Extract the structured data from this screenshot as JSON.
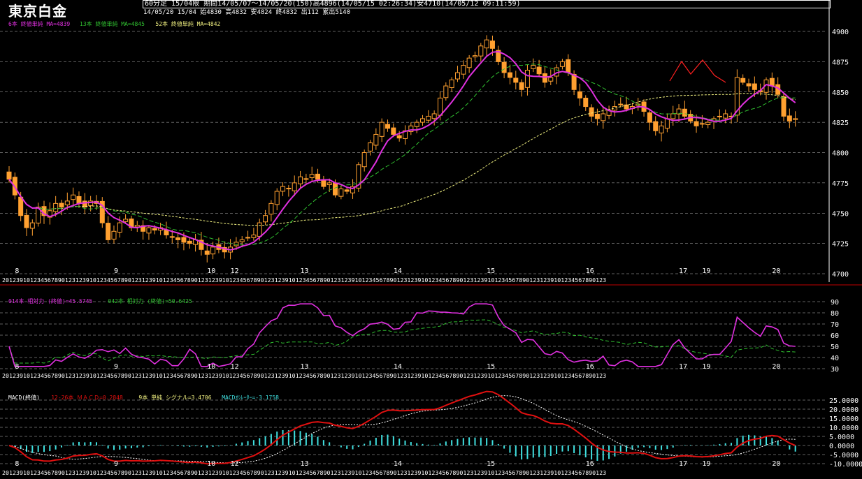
{
  "header": {
    "instrument": "東京白金",
    "line1": "60分足 15/04限  期間14/05/07～14/05/20(150)高4896(14/05/15 02:26:34)安4710(14/05/12 09:11:59)",
    "line2": "14/05/20 15/04 始4830 高4832 安4824 終4832 出112 累出5140"
  },
  "colors": {
    "candle": "#ffa030",
    "ma6": "#e030e0",
    "ma13": "#30c030",
    "ma52": "#f0f080",
    "macd": "#e01010",
    "signal": "#ffffff",
    "hist": "#40e0e0",
    "grid": "#c0c0c0",
    "separator": "#c00000",
    "pattern": "#ff2020"
  },
  "chart_data": [
    {
      "type": "candlestick",
      "panel": "price",
      "legend": [
        {
          "text": "6本 終値単純 MA=4839",
          "color": "#e030e0"
        },
        {
          "text": "13本 終値単純 MA=4845",
          "color": "#30c030"
        },
        {
          "text": "52本 終値単純 MA=4842",
          "color": "#f0f080"
        }
      ],
      "ylim": [
        4700,
        4910
      ],
      "y_ticks": [
        "4900",
        "4875",
        "4850",
        "4825",
        "4800",
        "4775",
        "4750",
        "4725",
        "4700"
      ],
      "day_labels": [
        {
          "label": "8",
          "bar": 1
        },
        {
          "label": "9",
          "bar": 18
        },
        {
          "label": "10",
          "bar": 34
        },
        {
          "label": "12",
          "bar": 38
        },
        {
          "label": "13",
          "bar": 50
        },
        {
          "label": "14",
          "bar": 66
        },
        {
          "label": "15",
          "bar": 82
        },
        {
          "label": "16",
          "bar": 99
        },
        {
          "label": "17",
          "bar": 115
        },
        {
          "label": "19",
          "bar": 119
        },
        {
          "label": "20",
          "bar": 131
        }
      ],
      "hour_row": "20123910123456789012312391012345678901231239101234567890123123910123456789012312391012345678901231239101234567890123123910123456789012312391012345678901231239101234567890123",
      "closes": [
        4778,
        4765,
        4748,
        4738,
        4742,
        4755,
        4748,
        4752,
        4758,
        4755,
        4760,
        4765,
        4758,
        4755,
        4760,
        4758,
        4742,
        4728,
        4735,
        4742,
        4745,
        4738,
        4740,
        4735,
        4738,
        4736,
        4738,
        4732,
        4730,
        4728,
        4726,
        4725,
        4728,
        4720,
        4716,
        4722,
        4720,
        4718,
        4722,
        4726,
        4728,
        4730,
        4732,
        4742,
        4748,
        4758,
        4768,
        4772,
        4770,
        4775,
        4780,
        4778,
        4782,
        4778,
        4772,
        4775,
        4765,
        4770,
        4768,
        4772,
        4790,
        4800,
        4808,
        4815,
        4825,
        4820,
        4815,
        4812,
        4818,
        4822,
        4825,
        4828,
        4830,
        4832,
        4845,
        4855,
        4860,
        4866,
        4872,
        4878,
        4880,
        4888,
        4893,
        4886,
        4875,
        4866,
        4862,
        4858,
        4852,
        4868,
        4872,
        4865,
        4858,
        4862,
        4870,
        4875,
        4866,
        4852,
        4845,
        4838,
        4830,
        4828,
        4832,
        4835,
        4838,
        4840,
        4836,
        4838,
        4840,
        4834,
        4825,
        4818,
        4822,
        4828,
        4832,
        4836,
        4830,
        4826,
        4822,
        4824,
        4825,
        4828,
        4830,
        4832,
        4830,
        4862,
        4858,
        4855,
        4852,
        4850,
        4860,
        4855,
        4848,
        4830,
        4826,
        4828
      ]
    },
    {
      "type": "line",
      "panel": "rsi",
      "legend": [
        {
          "text": "014本 相対力 (終値)=45.5745",
          "color": "#e030e0"
        },
        {
          "text": "042本 相対力 (終値)=50.6425",
          "color": "#30c030"
        }
      ],
      "ylim": [
        30,
        90
      ],
      "y_ticks": [
        "90",
        "80",
        "70",
        "60",
        "50",
        "40",
        "30"
      ]
    },
    {
      "type": "bar",
      "panel": "macd",
      "legend": [
        {
          "text": "MACD(終値)",
          "color": "#ffffff"
        },
        {
          "text": "12-26本 ＭＡＣＤ=0.2848",
          "color": "#e01010"
        },
        {
          "text": "9本 単純 シグナル=3.4706",
          "color": "#f0f080"
        },
        {
          "text": "MACDｵｼﾚｰﾀｰ=-3.1758",
          "color": "#40e0e0"
        }
      ],
      "ylim": [
        -10,
        25
      ],
      "y_ticks": [
        "25.0000",
        "20.0000",
        "15.0000",
        "10.0000",
        "5.0000",
        "0.0000",
        "-5.0000",
        "-10.0000"
      ]
    }
  ]
}
